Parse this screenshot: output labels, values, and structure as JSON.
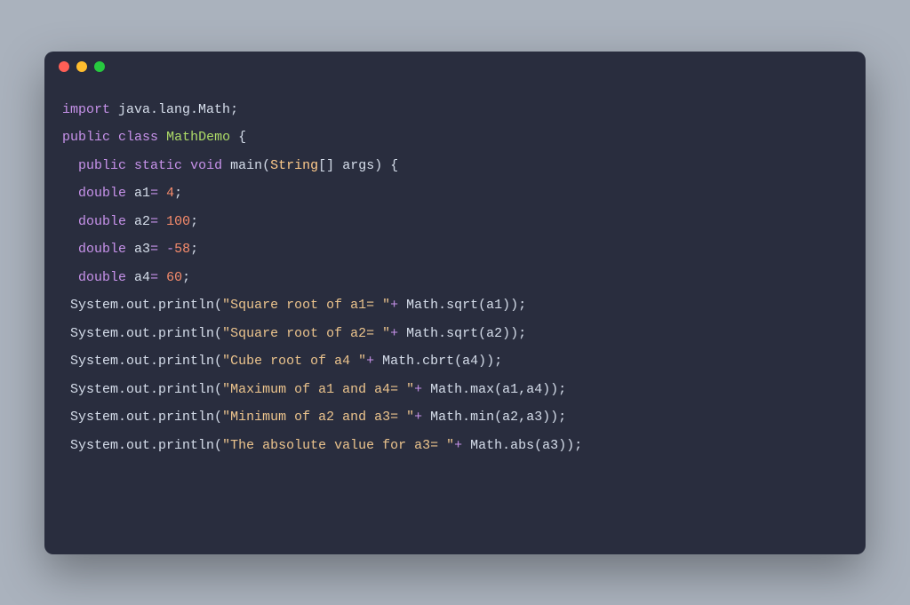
{
  "titlebar": {
    "dots": [
      "red",
      "yellow",
      "green"
    ]
  },
  "code": {
    "l1": {
      "import": "import",
      "pkg": "java.lang.Math",
      "semi": ";"
    },
    "l2": {
      "public": "public",
      "class": "class",
      "name": "MathDemo",
      "brace": "{"
    },
    "l3": {
      "public": "public",
      "static": "static",
      "void": "void",
      "main": "main",
      "lp": "(",
      "type": "String",
      "brackets": "[]",
      "args": "args",
      "rp": ")",
      "brace": "{"
    },
    "l4": {
      "double": "double",
      "var": "a1",
      "eq": "=",
      "val": "4",
      "semi": ";"
    },
    "l5": {
      "double": "double",
      "var": "a2",
      "eq": "=",
      "val": "100",
      "semi": ";"
    },
    "l6": {
      "double": "double",
      "var": "a3",
      "eq": "=",
      "neg": "-",
      "val": "58",
      "semi": ";"
    },
    "l7": {
      "double": "double",
      "var": "a4",
      "eq": "=",
      "val": "60",
      "semi": ";"
    },
    "l8": {
      "sys": "System.out.println",
      "lp": "(",
      "str": "\"Square root of a1= \"",
      "plus": "+",
      "call": "Math.sqrt",
      "lp2": "(",
      "arg": "a1",
      "rp2": ")",
      "rp": ")",
      "semi": ";"
    },
    "l9": {
      "sys": "System.out.println",
      "lp": "(",
      "str": "\"Square root of a2= \"",
      "plus": "+",
      "call": "Math.sqrt",
      "lp2": "(",
      "arg": "a2",
      "rp2": ")",
      "rp": ")",
      "semi": ";"
    },
    "l10": {
      "sys": "System.out.println",
      "lp": "(",
      "str": "\"Cube root of a4 \"",
      "plus": "+",
      "call": "Math.cbrt",
      "lp2": "(",
      "arg": "a4",
      "rp2": ")",
      "rp": ")",
      "semi": ";"
    },
    "l11": {
      "sys": "System.out.println",
      "lp": "(",
      "str": "\"Maximum of a1 and a4= \"",
      "plus": "+",
      "call": "Math.max",
      "lp2": "(",
      "arg1": "a1",
      "comma": ",",
      "arg2": "a4",
      "rp2": ")",
      "rp": ")",
      "semi": ";"
    },
    "l12": {
      "sys": "System.out.println",
      "lp": "(",
      "str": "\"Minimum of a2 and a3= \"",
      "plus": "+",
      "call": "Math.min",
      "lp2": "(",
      "arg1": "a2",
      "comma": ",",
      "arg2": "a3",
      "rp2": ")",
      "rp": ")",
      "semi": ";"
    },
    "l13": {
      "sys": "System.out.println",
      "lp": "(",
      "str": "\"The absolute value for a3= \"",
      "plus": "+",
      "call": "Math.abs",
      "lp2": "(",
      "arg": "a3",
      "rp2": ")",
      "rp": ")",
      "semi": ";"
    }
  }
}
